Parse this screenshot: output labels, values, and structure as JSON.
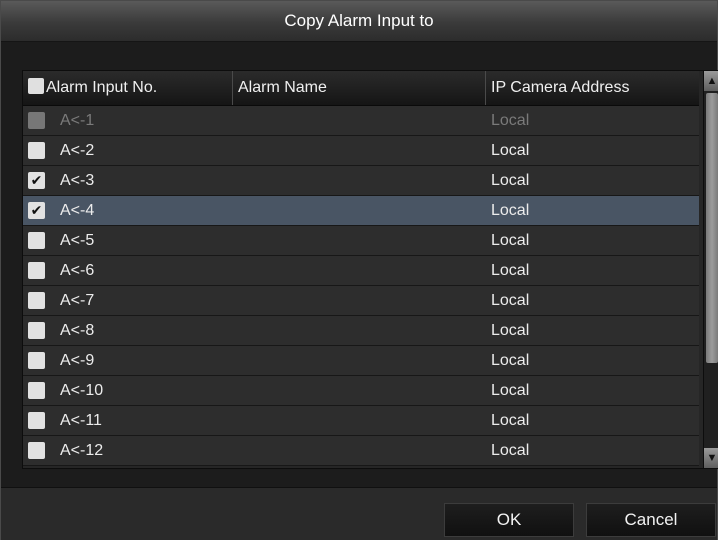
{
  "dialog": {
    "title": "Copy Alarm Input to"
  },
  "table": {
    "columns": [
      "Alarm Input No.",
      "Alarm Name",
      "IP Camera Address"
    ],
    "header_checkbox_checked": false,
    "rows": [
      {
        "no": "A<-1",
        "name": "",
        "address": "Local",
        "checked": false,
        "disabled": true,
        "selected": false
      },
      {
        "no": "A<-2",
        "name": "",
        "address": "Local",
        "checked": false,
        "disabled": false,
        "selected": false
      },
      {
        "no": "A<-3",
        "name": "",
        "address": "Local",
        "checked": true,
        "disabled": false,
        "selected": false
      },
      {
        "no": "A<-4",
        "name": "",
        "address": "Local",
        "checked": true,
        "disabled": false,
        "selected": true
      },
      {
        "no": "A<-5",
        "name": "",
        "address": "Local",
        "checked": false,
        "disabled": false,
        "selected": false
      },
      {
        "no": "A<-6",
        "name": "",
        "address": "Local",
        "checked": false,
        "disabled": false,
        "selected": false
      },
      {
        "no": "A<-7",
        "name": "",
        "address": "Local",
        "checked": false,
        "disabled": false,
        "selected": false
      },
      {
        "no": "A<-8",
        "name": "",
        "address": "Local",
        "checked": false,
        "disabled": false,
        "selected": false
      },
      {
        "no": "A<-9",
        "name": "",
        "address": "Local",
        "checked": false,
        "disabled": false,
        "selected": false
      },
      {
        "no": "A<-10",
        "name": "",
        "address": "Local",
        "checked": false,
        "disabled": false,
        "selected": false
      },
      {
        "no": "A<-11",
        "name": "",
        "address": "Local",
        "checked": false,
        "disabled": false,
        "selected": false
      },
      {
        "no": "A<-12",
        "name": "",
        "address": "Local",
        "checked": false,
        "disabled": false,
        "selected": false
      }
    ]
  },
  "scrollbar": {
    "up_icon": "chevron-up-icon",
    "down_icon": "chevron-down-icon"
  },
  "buttons": {
    "ok": "OK",
    "cancel": "Cancel"
  },
  "colors": {
    "selected_row": "#495564",
    "row_background": "#2d2d2d",
    "title_bar": "#3a3a3a"
  }
}
